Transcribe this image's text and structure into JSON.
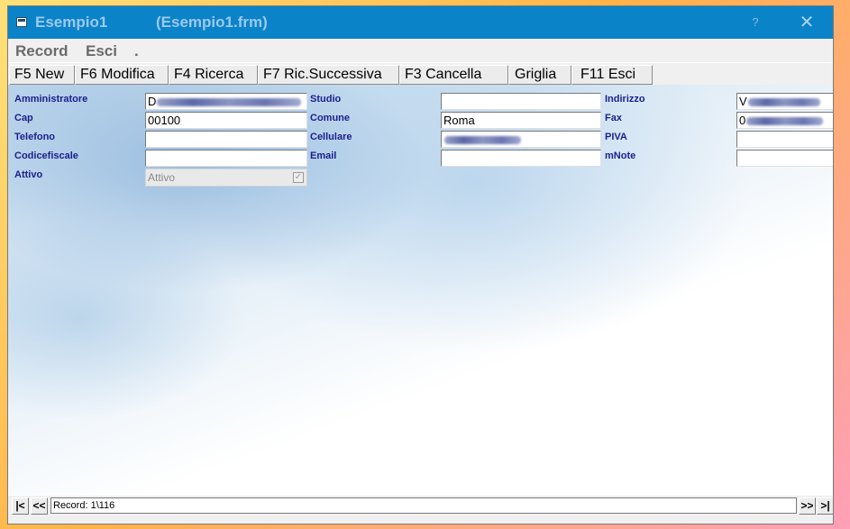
{
  "window": {
    "app_title": "Esempio1",
    "file_title": "(Esempio1.frm)",
    "help_label": "?",
    "close_label": "✕"
  },
  "menu": {
    "items": [
      "Record",
      "Esci",
      "."
    ]
  },
  "toolbar": {
    "buttons": [
      "F5 New",
      "F6 Modifica",
      "F4 Ricerca",
      "F7 Ric.Successiva",
      "F3 Cancella",
      "Griglia",
      "F11 Esci"
    ]
  },
  "form": {
    "col1": [
      {
        "label": "Amministratore",
        "value": "D"
      },
      {
        "label": "Cap",
        "value": "00100"
      },
      {
        "label": "Telefono",
        "value": ""
      },
      {
        "label": "Codicefiscale",
        "value": ""
      },
      {
        "label": "Attivo",
        "value": "Attivo",
        "checked": true
      }
    ],
    "col2": [
      {
        "label": "Studio",
        "value": ""
      },
      {
        "label": "Comune",
        "value": "Roma"
      },
      {
        "label": "Cellulare",
        "value": ""
      },
      {
        "label": "Email",
        "value": ""
      }
    ],
    "col3": [
      {
        "label": "Indirizzo",
        "value": "V"
      },
      {
        "label": "Fax",
        "value": "0"
      },
      {
        "label": "PIVA",
        "value": ""
      },
      {
        "label": "mNote",
        "value": ""
      }
    ]
  },
  "navigation": {
    "first_label": "|<",
    "prev_label": "<<",
    "record_text": "Record: 1\\116",
    "next_label": ">>",
    "last_label": ">|"
  }
}
